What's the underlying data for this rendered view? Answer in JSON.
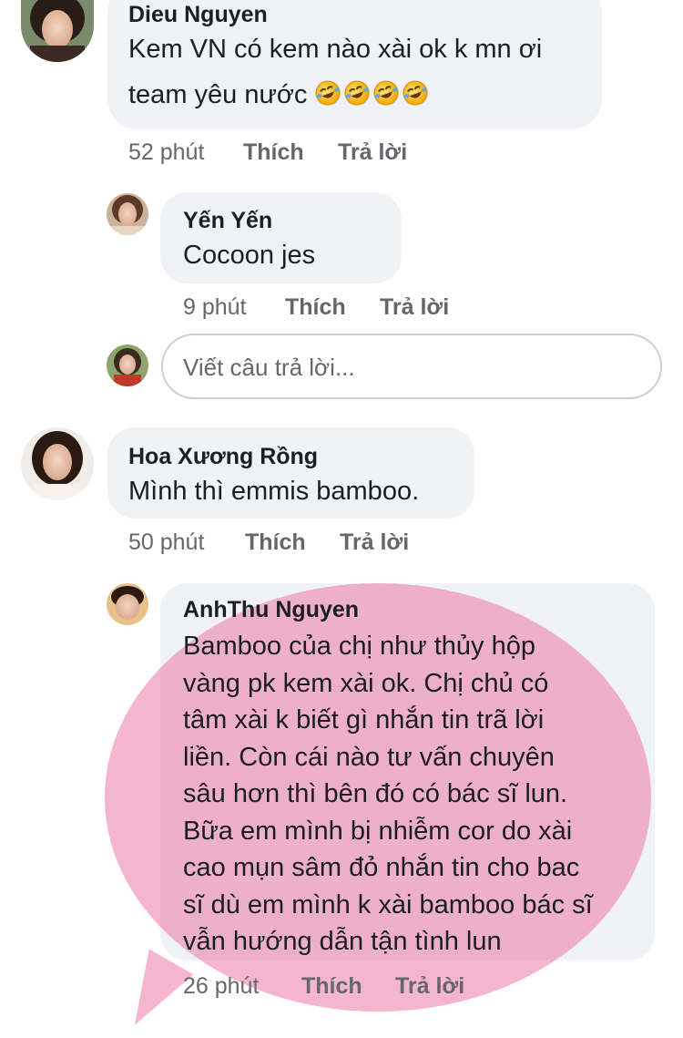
{
  "comments": [
    {
      "author": "Dieu Nguyen",
      "text_line1": "Kem VN có kem nào xài ok k mn ơi",
      "text_line2": "team yêu nước",
      "emoji_count": 4,
      "time": "52 phút",
      "like_label": "Thích",
      "reply_label": "Trả lời",
      "replies": [
        {
          "author": "Yến Yến",
          "text": "Cocoon jes",
          "time": "9 phút",
          "like_label": "Thích",
          "reply_label": "Trả lời"
        }
      ],
      "reply_input_placeholder": "Viết câu trả lời..."
    },
    {
      "author": "Hoa Xương Rồng",
      "text": "Mình thì emmis bamboo.",
      "time": "50 phút",
      "like_label": "Thích",
      "reply_label": "Trả lời",
      "replies": [
        {
          "author": "AnhThu Nguyen",
          "text_lines": [
            "Bamboo của chị như thủy hộp",
            "vàng pk kem xài ok. Chị chủ có",
            "tâm xài k biết gì nhắn tin trã lời",
            "liền. Còn cái nào tư vấn chuyên",
            "sâu hơn thì bên đó có bác sĩ lun.",
            "Bữa em mình bị nhiễm cor do xài",
            "cao mụn sâm đỏ nhắn tin cho bac",
            "sĩ dù em mình k xài bamboo bác sĩ",
            "vẫn hướng dẫn tận tình lun"
          ],
          "time": "26 phút",
          "like_label": "Thích",
          "reply_label": "Trả lời"
        }
      ]
    }
  ],
  "colors": {
    "bubble": "#f0f2f5",
    "meta_text": "#65676b",
    "highlight": "#ec78aa"
  },
  "icons": [
    "laughing-emoji-icon"
  ]
}
